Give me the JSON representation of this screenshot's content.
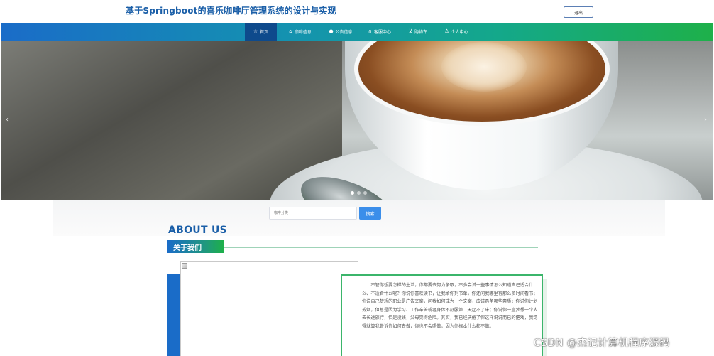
{
  "header": {
    "title": "基于Springboot的喜乐咖啡厅管理系统的设计与实现",
    "logout_label": "退出"
  },
  "nav": {
    "items": [
      {
        "label": "首页",
        "icon": "star-icon",
        "glyph": "☆",
        "active": true
      },
      {
        "label": "咖啡信息",
        "icon": "bag-icon",
        "glyph": "⌂",
        "active": false
      },
      {
        "label": "公告信息",
        "icon": "info-icon",
        "glyph": "●",
        "active": false
      },
      {
        "label": "客服中心",
        "icon": "headset-icon",
        "glyph": "∩",
        "active": false
      },
      {
        "label": "购物车",
        "icon": "cart-icon",
        "glyph": "⊻",
        "active": false
      },
      {
        "label": "个人中心",
        "icon": "user-icon",
        "glyph": "♙",
        "active": false
      }
    ],
    "colors": {
      "start": "#1a6cc8",
      "end": "#1eb04a",
      "active": "#0e4a8c"
    }
  },
  "banner": {
    "prev_glyph": "‹",
    "next_glyph": "›",
    "slide_count": 3,
    "active_slide": 1
  },
  "search": {
    "placeholder": "咖啡分类",
    "button_label": "搜索"
  },
  "about": {
    "title_en": "ABOUT US",
    "title_cn": "关于我们",
    "text": "不管你想要怎样的生活，你都要去努力争取，不多尝试一些事情怎么知道自己适合什么、不适合什么呢？你说你喜欢读书，让我给你列书单，你还问我哪里有那么多时间看书；你说自己梦想的职业是广告文案，问我如何成为一个文案，应该具备哪些素质；你说你计划戒烟，但总是因为学习、工作辛苦或者身体不舒服第二天起不了床；你说你一直梦想一个人去长途旅行，但是没钱，父母觉得危险。其实，我已经厌倦了你这样说说而已的把戏，我觉得就算我告诉你如何去做，你也不会照做，因为你根本什么都不做。"
  },
  "watermark": "CSDN @杰记计算机程序源码"
}
